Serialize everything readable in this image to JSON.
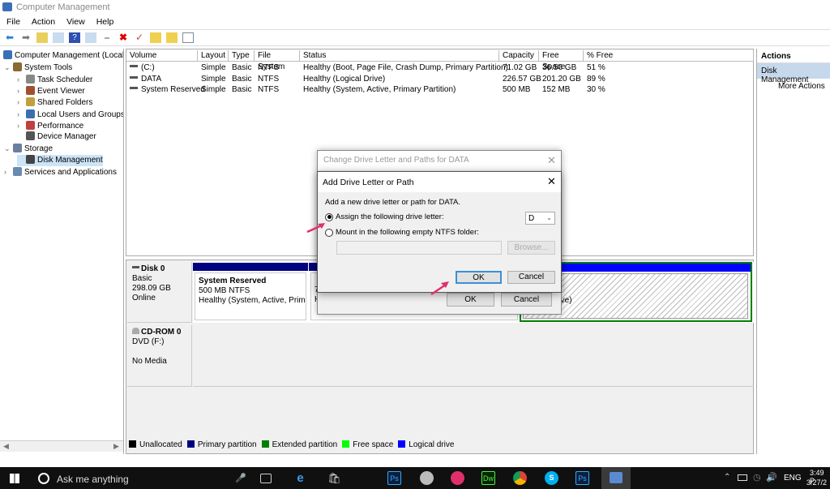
{
  "window": {
    "title": "Computer Management"
  },
  "menu": [
    "File",
    "Action",
    "View",
    "Help"
  ],
  "tree": {
    "items": [
      {
        "label": "Computer Management (Local",
        "level": 0,
        "expander": ""
      },
      {
        "label": "System Tools",
        "level": 1,
        "expander": "v"
      },
      {
        "label": "Task Scheduler",
        "level": 2,
        "expander": ">"
      },
      {
        "label": "Event Viewer",
        "level": 2,
        "expander": ">"
      },
      {
        "label": "Shared Folders",
        "level": 2,
        "expander": ">"
      },
      {
        "label": "Local Users and Groups",
        "level": 2,
        "expander": ">"
      },
      {
        "label": "Performance",
        "level": 2,
        "expander": ">"
      },
      {
        "label": "Device Manager",
        "level": 2,
        "expander": ""
      },
      {
        "label": "Storage",
        "level": 1,
        "expander": "v"
      },
      {
        "label": "Disk Management",
        "level": 2,
        "expander": "",
        "selected": true
      },
      {
        "label": "Services and Applications",
        "level": 1,
        "expander": ">"
      }
    ]
  },
  "volumes": {
    "columns": [
      "Volume",
      "Layout",
      "Type",
      "File System",
      "Status",
      "Capacity",
      "Free Space",
      "% Free"
    ],
    "rows": [
      [
        "(C:)",
        "Simple",
        "Basic",
        "NTFS",
        "Healthy (Boot, Page File, Crash Dump, Primary Partition)",
        "71.02 GB",
        "36.56 GB",
        "51 %"
      ],
      [
        "DATA",
        "Simple",
        "Basic",
        "NTFS",
        "Healthy (Logical Drive)",
        "226.57 GB",
        "201.20 GB",
        "89 %"
      ],
      [
        "System Reserved",
        "Simple",
        "Basic",
        "NTFS",
        "Healthy (System, Active, Primary Partition)",
        "500 MB",
        "152 MB",
        "30 %"
      ]
    ]
  },
  "disks": {
    "disk0": {
      "name": "Disk 0",
      "type": "Basic",
      "size": "298.09 GB",
      "status": "Online",
      "partition1": {
        "name": "System Reserved",
        "size": "500 MB NTFS",
        "status": "Healthy (System, Active, Primar"
      },
      "partition2_fragment": [
        "7",
        "H"
      ],
      "partition3_fragment": {
        "fs": "NTFS",
        "status": "ogical Drive)"
      }
    },
    "cdrom0": {
      "name": "CD-ROM 0",
      "type": "DVD (F:)",
      "status": "No Media"
    }
  },
  "legend": [
    {
      "label": "Unallocated",
      "color": "#000000"
    },
    {
      "label": "Primary partition",
      "color": "#000080"
    },
    {
      "label": "Extended partition",
      "color": "#008000"
    },
    {
      "label": "Free space",
      "color": "#00ff00"
    },
    {
      "label": "Logical drive",
      "color": "#0000ff"
    }
  ],
  "actions": {
    "header": "Actions",
    "section": "Disk Management",
    "more": "More Actions"
  },
  "back_dialog": {
    "title": "Change Drive Letter and Paths for DATA",
    "ok": "OK",
    "cancel": "Cancel"
  },
  "dialog": {
    "title": "Add Drive Letter or Path",
    "prompt": "Add a new drive letter or path for DATA.",
    "option_assign": "Assign the following drive letter:",
    "option_mount": "Mount in the following empty NTFS folder:",
    "selected_option": "assign",
    "drive_letter": "D",
    "folder_path": "",
    "browse": "Browse...",
    "ok": "OK",
    "cancel": "Cancel"
  },
  "taskbar": {
    "search_placeholder": "Ask me anything",
    "language": "ENG",
    "time": "3:49 P",
    "date": "3/27/2",
    "apps": [
      "Ps",
      "Dw",
      "Ps"
    ]
  },
  "colors": {
    "accent_arrow": "#e0306a",
    "selection": "#cce4f7"
  }
}
